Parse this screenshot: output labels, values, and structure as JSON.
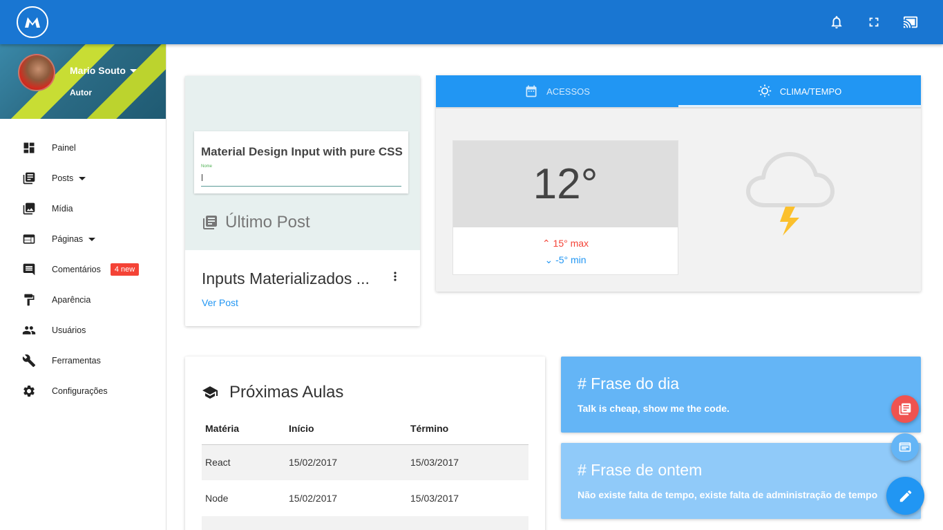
{
  "topbar": {
    "logo_icon": "m-logo-icon",
    "icons": [
      "bell-icon",
      "fullscreen-icon",
      "cast-icon"
    ]
  },
  "profile": {
    "name": "Mario Souto",
    "role": "Autor"
  },
  "nav": {
    "items": [
      {
        "label": "Painel",
        "icon": "dashboard-icon"
      },
      {
        "label": "Posts",
        "icon": "posts-icon"
      },
      {
        "label": "Mídia",
        "icon": "media-icon"
      },
      {
        "label": "Páginas",
        "icon": "pages-icon"
      },
      {
        "label": "Comentários",
        "icon": "comments-icon",
        "badge": "4 new"
      },
      {
        "label": "Aparência",
        "icon": "paint-roller-icon"
      },
      {
        "label": "Usuários",
        "icon": "users-icon"
      },
      {
        "label": "Ferramentas",
        "icon": "wrench-icon"
      },
      {
        "label": "Configurações",
        "icon": "gear-icon"
      }
    ]
  },
  "post": {
    "thumb_title": "Material Design Input with pure CSS",
    "thumb_field_label": "Nome",
    "section_label": "Último Post",
    "title": "Inputs Materializados ...",
    "link": "Ver Post"
  },
  "weather": {
    "tabs": [
      {
        "label": "ACESSOS",
        "icon": "calendar-icon",
        "active": false
      },
      {
        "label": "CLIMA/TEMPO",
        "icon": "sun-icon",
        "active": true
      }
    ],
    "temperature": "12°",
    "max": "15° max",
    "min": "-5° min",
    "condition_icon": "storm-cloud-icon"
  },
  "classes": {
    "title": "Próximas Aulas",
    "columns": [
      "Matéria",
      "Início",
      "Término"
    ],
    "rows": [
      [
        "React",
        "15/02/2017",
        "15/03/2017"
      ],
      [
        "Node",
        "15/02/2017",
        "15/03/2017"
      ],
      [
        "",
        "",
        ""
      ]
    ]
  },
  "quotes": {
    "today_title": "# Frase do dia",
    "today_text": "Talk is cheap, show me the code.",
    "yesterday_title": "# Frase de ontem",
    "yesterday_text": "Não existe falta de tempo, existe falta de administração de tempo"
  },
  "fabs": [
    "post-fab-icon",
    "page-fab-icon",
    "pencil-icon"
  ],
  "colors": {
    "primary": "#1976d2",
    "tab_bar": "#2196f3",
    "badge": "#f44336",
    "quote_today": "#64b5f6",
    "quote_yesterday": "#90caf9"
  }
}
